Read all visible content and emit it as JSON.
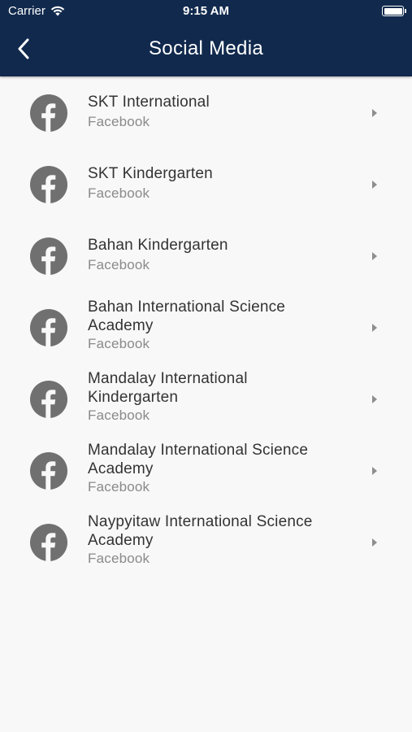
{
  "status_bar": {
    "carrier": "Carrier",
    "time": "9:15 AM"
  },
  "header": {
    "title": "Social Media",
    "background": "#11294d"
  },
  "colors": {
    "icon_gray": "#707070",
    "title_text": "#333333",
    "subtitle_text": "#8a8a8a"
  },
  "items": [
    {
      "title_lines": [
        "SKT International"
      ],
      "subtitle": "Facebook",
      "icon": "facebook-icon"
    },
    {
      "title_lines": [
        "SKT Kindergarten"
      ],
      "subtitle": "Facebook",
      "icon": "facebook-icon"
    },
    {
      "title_lines": [
        "Bahan Kindergarten"
      ],
      "subtitle": "Facebook",
      "icon": "facebook-icon"
    },
    {
      "title_lines": [
        "Bahan International Science",
        "Academy"
      ],
      "subtitle": "Facebook",
      "icon": "facebook-icon"
    },
    {
      "title_lines": [
        "Mandalay International",
        "Kindergarten"
      ],
      "subtitle": "Facebook",
      "icon": "facebook-icon"
    },
    {
      "title_lines": [
        "Mandalay International Science",
        "Academy"
      ],
      "subtitle": "Facebook",
      "icon": "facebook-icon"
    },
    {
      "title_lines": [
        "Naypyitaw International Science",
        "Academy"
      ],
      "subtitle": "Facebook",
      "icon": "facebook-icon"
    }
  ]
}
